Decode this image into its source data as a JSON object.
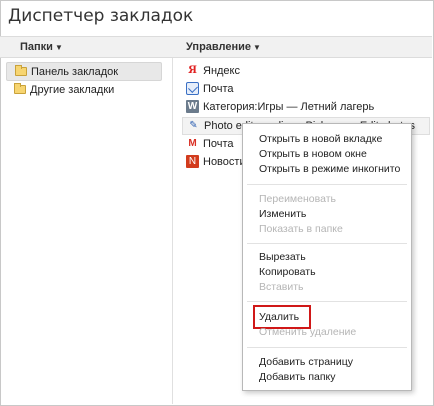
{
  "window": {
    "title": "Диспетчер закладок"
  },
  "header": {
    "folders_label": "Папки",
    "organize_label": "Управление",
    "dropdown_arrow": "▼"
  },
  "tree": {
    "items": [
      {
        "label": "Панель закладок",
        "selected": true,
        "icon": "folder-icon"
      },
      {
        "label": "Другие закладки",
        "selected": false,
        "icon": "folder-icon"
      }
    ]
  },
  "bookmarks": {
    "items": [
      {
        "label": "Яндекс",
        "icon": "yandex-icon",
        "glyph": "Я"
      },
      {
        "label": "Почта",
        "icon": "mail-icon",
        "glyph": ""
      },
      {
        "label": "Категория:Игры — Летний лагерь",
        "icon": "wiki-icon",
        "glyph": "W"
      },
      {
        "label": "Photo editor online - Pixlr.com - Edit photos",
        "icon": "pen-icon",
        "glyph": "✎"
      },
      {
        "label": "Почта",
        "icon": "gmail-icon",
        "glyph": "M"
      },
      {
        "label": "Новости",
        "icon": "news-icon",
        "glyph": "N"
      }
    ]
  },
  "context_menu": {
    "open_new_tab": "Открыть в новой вкладке",
    "open_new_window": "Открыть в новом окне",
    "open_incognito": "Открыть в режиме инкогнито",
    "rename": "Переименовать",
    "edit": "Изменить",
    "show_in_folder": "Показать в папке",
    "cut": "Вырезать",
    "copy": "Копировать",
    "paste": "Вставить",
    "delete": "Удалить",
    "undo_delete": "Отменить удаление",
    "add_page": "Добавить страницу",
    "add_folder": "Добавить папку"
  },
  "colors": {
    "highlight_border": "#d01818",
    "folder": "#f7d571"
  }
}
